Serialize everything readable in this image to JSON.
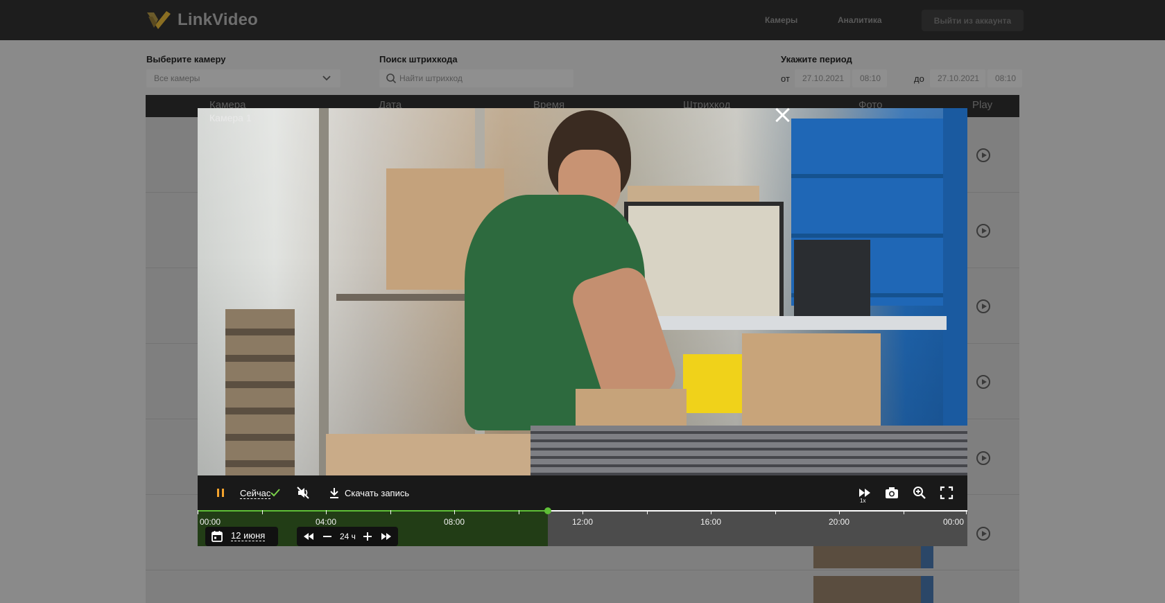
{
  "header": {
    "logo_text": "LinkVideo",
    "nav": [
      {
        "label": "Камеры"
      },
      {
        "label": "Аналитика"
      }
    ],
    "logout_label": "Выйти из аккаунта"
  },
  "filters": {
    "camera": {
      "label": "Выберите камеру",
      "value": "Все камеры"
    },
    "barcode": {
      "label": "Поиск штрихкода",
      "placeholder": "Найти штрихкод"
    },
    "period": {
      "label": "Укажите период",
      "from_prefix": "от",
      "from_date": "27.10.2021",
      "from_time": "08:10",
      "to_prefix": "до",
      "to_date": "27.10.2021",
      "to_time": "08:10"
    }
  },
  "table": {
    "columns": [
      "Камера",
      "Дата",
      "Время",
      "Штрихкод",
      "Фото",
      "Play"
    ]
  },
  "player": {
    "camera_name": "Камера 1",
    "now_label": "Сейчас",
    "download_label": "Скачать запись",
    "speed_label": "1x",
    "date_label": "12 июня",
    "zoom_label": "24 ч",
    "progress_fraction": 0.455,
    "timeline_labels": [
      "00:00",
      "04:00",
      "08:00",
      "12:00",
      "16:00",
      "20:00",
      "00:00"
    ],
    "colors": {
      "accent_green": "#5fbf37",
      "pause_orange": "#f4a32d"
    },
    "icons": [
      "pause-icon",
      "check-icon",
      "mute-icon",
      "download-icon",
      "fast-forward-icon",
      "camera-icon",
      "zoom-in-icon",
      "fullscreen-icon",
      "calendar-icon",
      "rewind-icon",
      "minus-icon",
      "plus-icon",
      "close-icon"
    ]
  }
}
